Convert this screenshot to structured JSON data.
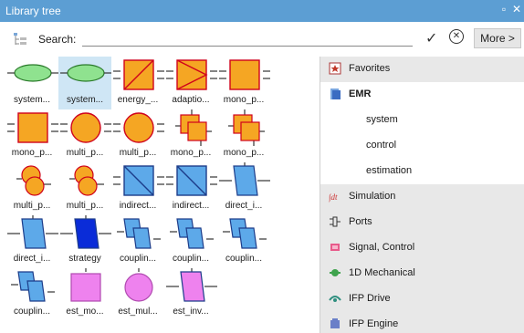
{
  "window": {
    "title": "Library tree",
    "pin_glyph": "▫",
    "close_glyph": "✕"
  },
  "toolbar": {
    "search_label": "Search:",
    "search_value": "",
    "confirm_glyph": "✓",
    "clear_glyph": "✕",
    "more_label": "More >"
  },
  "blocks": [
    {
      "label": "system...",
      "shape": "ellipse-green"
    },
    {
      "label": "system...",
      "shape": "ellipse-green"
    },
    {
      "label": "energy_...",
      "shape": "square-diag"
    },
    {
      "label": "adaptio...",
      "shape": "square-triangle"
    },
    {
      "label": "mono_p...",
      "shape": "square"
    },
    {
      "label": "mono_p...",
      "shape": "square"
    },
    {
      "label": "multi_p...",
      "shape": "circle"
    },
    {
      "label": "multi_p...",
      "shape": "circle"
    },
    {
      "label": "mono_p...",
      "shape": "square-stack"
    },
    {
      "label": "mono_p...",
      "shape": "square-stack"
    },
    {
      "label": "multi_p...",
      "shape": "circle-stack"
    },
    {
      "label": "multi_p...",
      "shape": "circle-stack"
    },
    {
      "label": "indirect...",
      "shape": "square-diag-blue"
    },
    {
      "label": "indirect...",
      "shape": "square-diag-blue"
    },
    {
      "label": "direct_i...",
      "shape": "parallelogram"
    },
    {
      "label": "direct_i...",
      "shape": "parallelogram"
    },
    {
      "label": "strategy",
      "shape": "parallelogram-dark"
    },
    {
      "label": "couplin...",
      "shape": "parallelogram-stack"
    },
    {
      "label": "couplin...",
      "shape": "parallelogram-stack"
    },
    {
      "label": "couplin...",
      "shape": "parallelogram-stack"
    },
    {
      "label": "couplin...",
      "shape": "parallelogram-stack"
    },
    {
      "label": "est_mo...",
      "shape": "square-magenta"
    },
    {
      "label": "est_mul...",
      "shape": "circle-magenta"
    },
    {
      "label": "est_inv...",
      "shape": "parallelogram-magenta"
    }
  ],
  "sidebar": {
    "items": [
      {
        "label": "Favorites",
        "icon": "star-icon",
        "kind": "header"
      },
      {
        "label": "EMR",
        "icon": "emr-icon",
        "kind": "active"
      },
      {
        "label": "system",
        "icon": "",
        "kind": "sub"
      },
      {
        "label": "control",
        "icon": "",
        "kind": "sub"
      },
      {
        "label": "estimation",
        "icon": "",
        "kind": "sub"
      },
      {
        "label": "Simulation",
        "icon": "simulation-icon",
        "kind": "header"
      },
      {
        "label": "Ports",
        "icon": "ports-icon",
        "kind": "header"
      },
      {
        "label": "Signal, Control",
        "icon": "signal-icon",
        "kind": "header"
      },
      {
        "label": "1D Mechanical",
        "icon": "mechanical-icon",
        "kind": "header"
      },
      {
        "label": "IFP Drive",
        "icon": "drive-icon",
        "kind": "header"
      },
      {
        "label": "IFP Engine",
        "icon": "engine-icon",
        "kind": "header"
      }
    ]
  },
  "colors": {
    "titlebar": "#5c9ed3",
    "block_orange": "#f5a623",
    "block_outline": "#d0021b",
    "block_green": "#8fe28f",
    "block_blue": "#5da9e9",
    "block_dark_blue": "#0a2cd8",
    "block_magenta": "#ee82ee",
    "selection": "#cfe6f5",
    "sidebar_bg": "#e8e8e8"
  }
}
